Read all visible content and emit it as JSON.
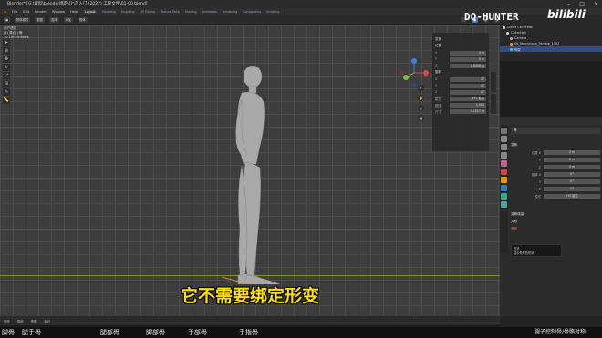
{
  "window": {
    "title": "Blender* [G:\\資料\\blender绑定\\[匕首入门 (2022) 工程文件\\01-00.blend]"
  },
  "menu": {
    "items": [
      "File",
      "Edit",
      "Render",
      "Window",
      "Help"
    ],
    "workspaces": [
      "Layout",
      "Modeling",
      "Sculpting",
      "UV Editing",
      "Texture Paint",
      "Shading",
      "Animation",
      "Rendering",
      "Compositing",
      "Scripting"
    ]
  },
  "viewport": {
    "mode_label": "物体模式",
    "menu_items": [
      "视图",
      "选择",
      "添加",
      "物体"
    ],
    "info_line1": "用户透视",
    "info_line2": "(1) 集合 | 骨",
    "info_line3": "10 Centimeters"
  },
  "npanel": {
    "section_transform": "变换",
    "location_label": "位置",
    "rows": [
      {
        "label": "X",
        "value": "0 m"
      },
      {
        "label": "Y",
        "value": "0 m"
      },
      {
        "label": "Z",
        "value": "0.8406 m"
      },
      {
        "label": "旋转",
        "value": ""
      },
      {
        "label": "X",
        "value": "0°"
      },
      {
        "label": "Y",
        "value": "0°"
      },
      {
        "label": "Z",
        "value": "0°"
      },
      {
        "label": "模式",
        "value": "XYZ 欧拉"
      },
      {
        "label": "缩放",
        "value": "1.000"
      },
      {
        "label": "尺寸",
        "value": "0.1017 m"
      }
    ]
  },
  "outliner": {
    "rows": [
      {
        "label": "Scene Collection",
        "selected": false
      },
      {
        "label": "Collection",
        "selected": false
      },
      {
        "label": "Camera",
        "selected": false
      },
      {
        "label": "SK_Mannequin_Female_1002",
        "selected": false
      },
      {
        "label": "骨架",
        "selected": true
      }
    ]
  },
  "properties": {
    "object_name": "骨",
    "section_transform": "变换",
    "rows": [
      {
        "label": "位置 X",
        "value": "0 m"
      },
      {
        "label": "Y",
        "value": "0 m"
      },
      {
        "label": "Z",
        "value": "0 m"
      },
      {
        "label": "旋转 X",
        "value": "0°"
      },
      {
        "label": "Y",
        "value": "0°"
      },
      {
        "label": "Z",
        "value": "0°"
      },
      {
        "label": "模式",
        "value": "XYZ 欧拉"
      }
    ],
    "section_relations": "变换增量",
    "section_extras": "关系",
    "option_label": "骨架",
    "tooltip_line1": "形状",
    "tooltip_line2": "显示骨架的形状"
  },
  "watermark": {
    "brand": "DQ-HUNTER",
    "site": "bilibili"
  },
  "subtitle": "它不需要绑定形变",
  "timeline": {
    "items": [
      "回放",
      "插帧",
      "视图",
      "标记"
    ]
  },
  "bottom_labels": [
    "脚骨",
    "腿手骨",
    "腿部骨",
    "脚部骨",
    "手部骨",
    "手指骨",
    "腿子控制骨/骨骼对称"
  ],
  "colors": {
    "selection": "#334d80",
    "subtitle": "#ffe100",
    "axis_x": "#e04050",
    "axis_y": "#80c040",
    "axis_z": "#4080e0"
  }
}
